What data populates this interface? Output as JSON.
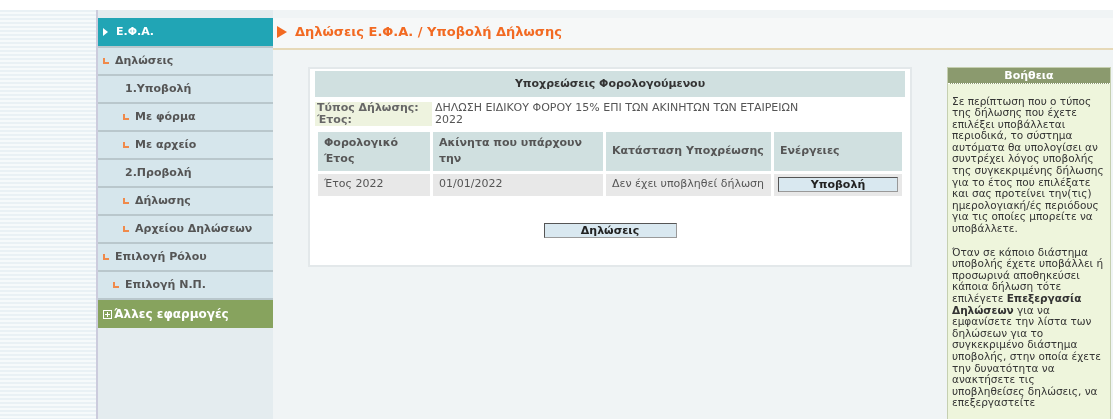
{
  "sidebar": {
    "items": [
      {
        "label": "Ε.Φ.Α.",
        "kind": "header",
        "selected": true,
        "bullet": false
      },
      {
        "label": "Δηλώσεις",
        "kind": "item",
        "selected": false,
        "bullet": true,
        "children": [
          {
            "label": "1.Υποβολή",
            "kind": "item",
            "selected": false,
            "bullet": false,
            "children": [
              {
                "label": "Με φόρμα",
                "kind": "item",
                "selected": false,
                "bullet": true
              },
              {
                "label": "Με αρχείο",
                "kind": "item",
                "selected": false,
                "bullet": true
              }
            ]
          },
          {
            "label": "2.Προβολή",
            "kind": "item",
            "selected": false,
            "bullet": false,
            "children": [
              {
                "label": "Δήλωσης",
                "kind": "item",
                "selected": false,
                "bullet": true
              },
              {
                "label": "Αρχείου Δηλώσεων",
                "kind": "item",
                "selected": false,
                "bullet": true
              }
            ]
          }
        ]
      },
      {
        "label": "Επιλογή Ρόλου",
        "kind": "item",
        "selected": false,
        "bullet": true,
        "children": [
          {
            "label": "Επιλογή Ν.Π.",
            "kind": "item",
            "selected": false,
            "bullet": true
          }
        ]
      },
      {
        "label": "Άλλες εφαρμογές",
        "kind": "group",
        "selected": false,
        "bullet": false
      }
    ]
  },
  "breadcrumb": "Δηλώσεις Ε.Φ.Α. / Υποβολή Δήλωσης",
  "card": {
    "title": "Υποχρεώσεις Φορολογούμενου",
    "info": [
      {
        "label": "Τύπος Δήλωσης:",
        "value": "ΔΗΛΩΣΗ ΕΙΔΙΚΟΥ ΦΟΡΟΥ 15% ΕΠΙ ΤΩΝ ΑΚΙΝΗΤΩΝ ΤΩΝ ΕΤΑΙΡΕΙΩΝ"
      },
      {
        "label": "Έτος:",
        "value": "2022"
      }
    ],
    "table": {
      "columns": [
        "Φορολογικό Έτος",
        "Ακίνητα που υπάρχουν την",
        "Κατάσταση Υποχρέωσης",
        "Ενέργειες"
      ],
      "rows": [
        {
          "cells": [
            "Έτος 2022",
            "01/01/2022",
            "Δεν έχει υποβληθεί δήλωση"
          ],
          "action": "Υποβολή"
        }
      ]
    },
    "button": "Δηλώσεις"
  },
  "help": {
    "title": "Βοήθεια",
    "paragraphs": [
      "Σε περίπτωση που ο τύπος της δήλωσης που έχετε επιλέξει υποβάλλεται περιοδικά, το σύστημα αυτόματα θα υπολογίσει αν συντρέχει λόγος υποβολής της συγκεκριμένης δήλωσης για το έτος που επιλέξατε και σας προτείνει την(τις) ημερολογιακή/ές περιόδους για τις οποίες μπορείτε να υποβάλλετε.",
      "Όταν σε κάποιο διάστημα υποβολής έχετε υποβάλλει ή προσωρινά αποθηκεύσει κάποια δήλωση τότε επιλέγετε **Επεξεργασία Δηλώσεων** για να εμφανίσετε την λίστα των δηλώσεων για το συγκεκριμένο διάστημα υποβολής, στην οποία έχετε την δυνατότητα να ανακτήσετε τις υποβληθείσες δηλώσεις, να επεξεργαστείτε"
    ]
  }
}
